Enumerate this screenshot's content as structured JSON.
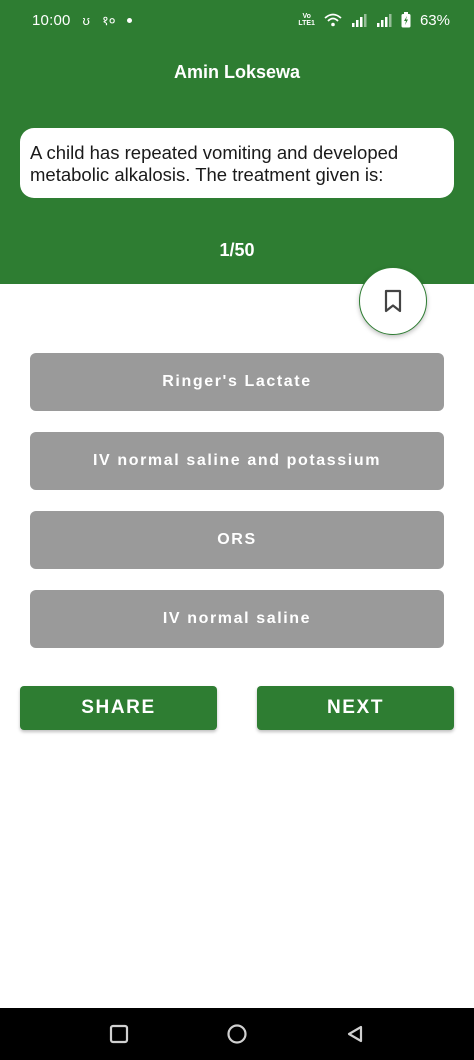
{
  "status_bar": {
    "time": "10:00",
    "left_glyph_1": "ʊ",
    "left_glyph_2": "१०",
    "lte_top": "Vo",
    "lte_bottom": "LTE1",
    "battery_percent": "63%"
  },
  "header": {
    "title": "Amin Loksewa"
  },
  "question": {
    "text": "A child has repeated vomiting and developed metabolic alkalosis. The treatment given is:",
    "counter": "1/50"
  },
  "options": [
    {
      "label": "Ringer's Lactate"
    },
    {
      "label": "IV normal saline and potassium"
    },
    {
      "label": "ORS"
    },
    {
      "label": "IV normal saline"
    }
  ],
  "actions": {
    "share_label": "SHARE",
    "next_label": "NEXT"
  },
  "colors": {
    "primary_green": "#2e7d32",
    "option_gray": "#9a9a9a",
    "nav_bar": "#000000"
  },
  "icons": {
    "bookmark": "bookmark-outline-icon",
    "nav_recent": "square-icon",
    "nav_home": "circle-icon",
    "nav_back": "triangle-back-icon"
  }
}
